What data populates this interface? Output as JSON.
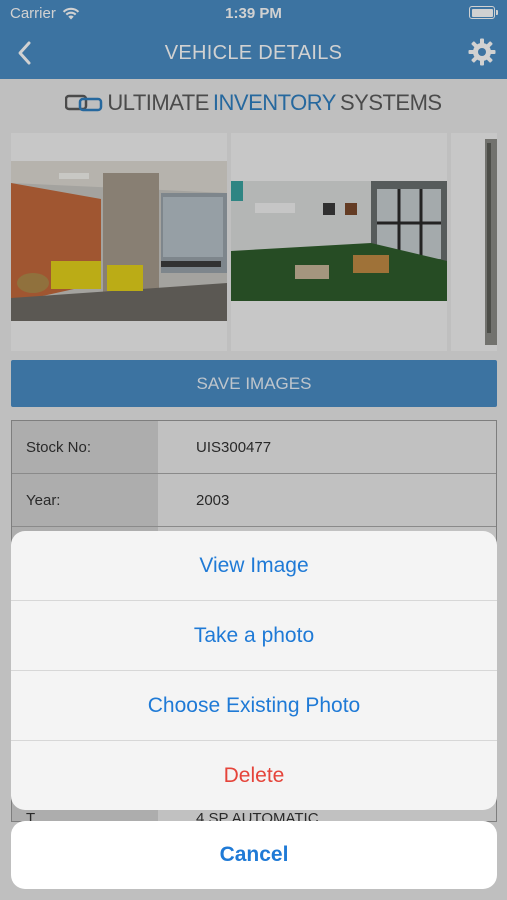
{
  "status_bar": {
    "carrier": "Carrier",
    "time": "1:39 PM"
  },
  "nav": {
    "title": "VEHICLE DETAILS",
    "back_icon": "chevron-left-icon",
    "settings_icon": "gear-icon"
  },
  "logo": {
    "part1": "ULTIMATE",
    "part2": "INVENTORY",
    "part3": "SYSTEMS"
  },
  "save_images_label": "SAVE IMAGES",
  "details": [
    {
      "label": "Stock No:",
      "value": "UIS300477"
    },
    {
      "label": "Year:",
      "value": "2003"
    },
    {
      "label": "",
      "value": ""
    },
    {
      "label": "",
      "value": ""
    },
    {
      "label": "",
      "value": ""
    },
    {
      "label": "",
      "value": ""
    },
    {
      "label": "",
      "value": ""
    },
    {
      "label": "T",
      "value": "4 SP AUTOMATIC"
    }
  ],
  "action_sheet": {
    "items": [
      {
        "label": "View Image"
      },
      {
        "label": "Take a photo"
      },
      {
        "label": "Choose Existing Photo"
      },
      {
        "label": "Delete"
      }
    ],
    "cancel_label": "Cancel"
  },
  "colors": {
    "accent": "#4a8dc5",
    "action_blue": "#1f7ad6",
    "destructive": "#e5443a"
  }
}
